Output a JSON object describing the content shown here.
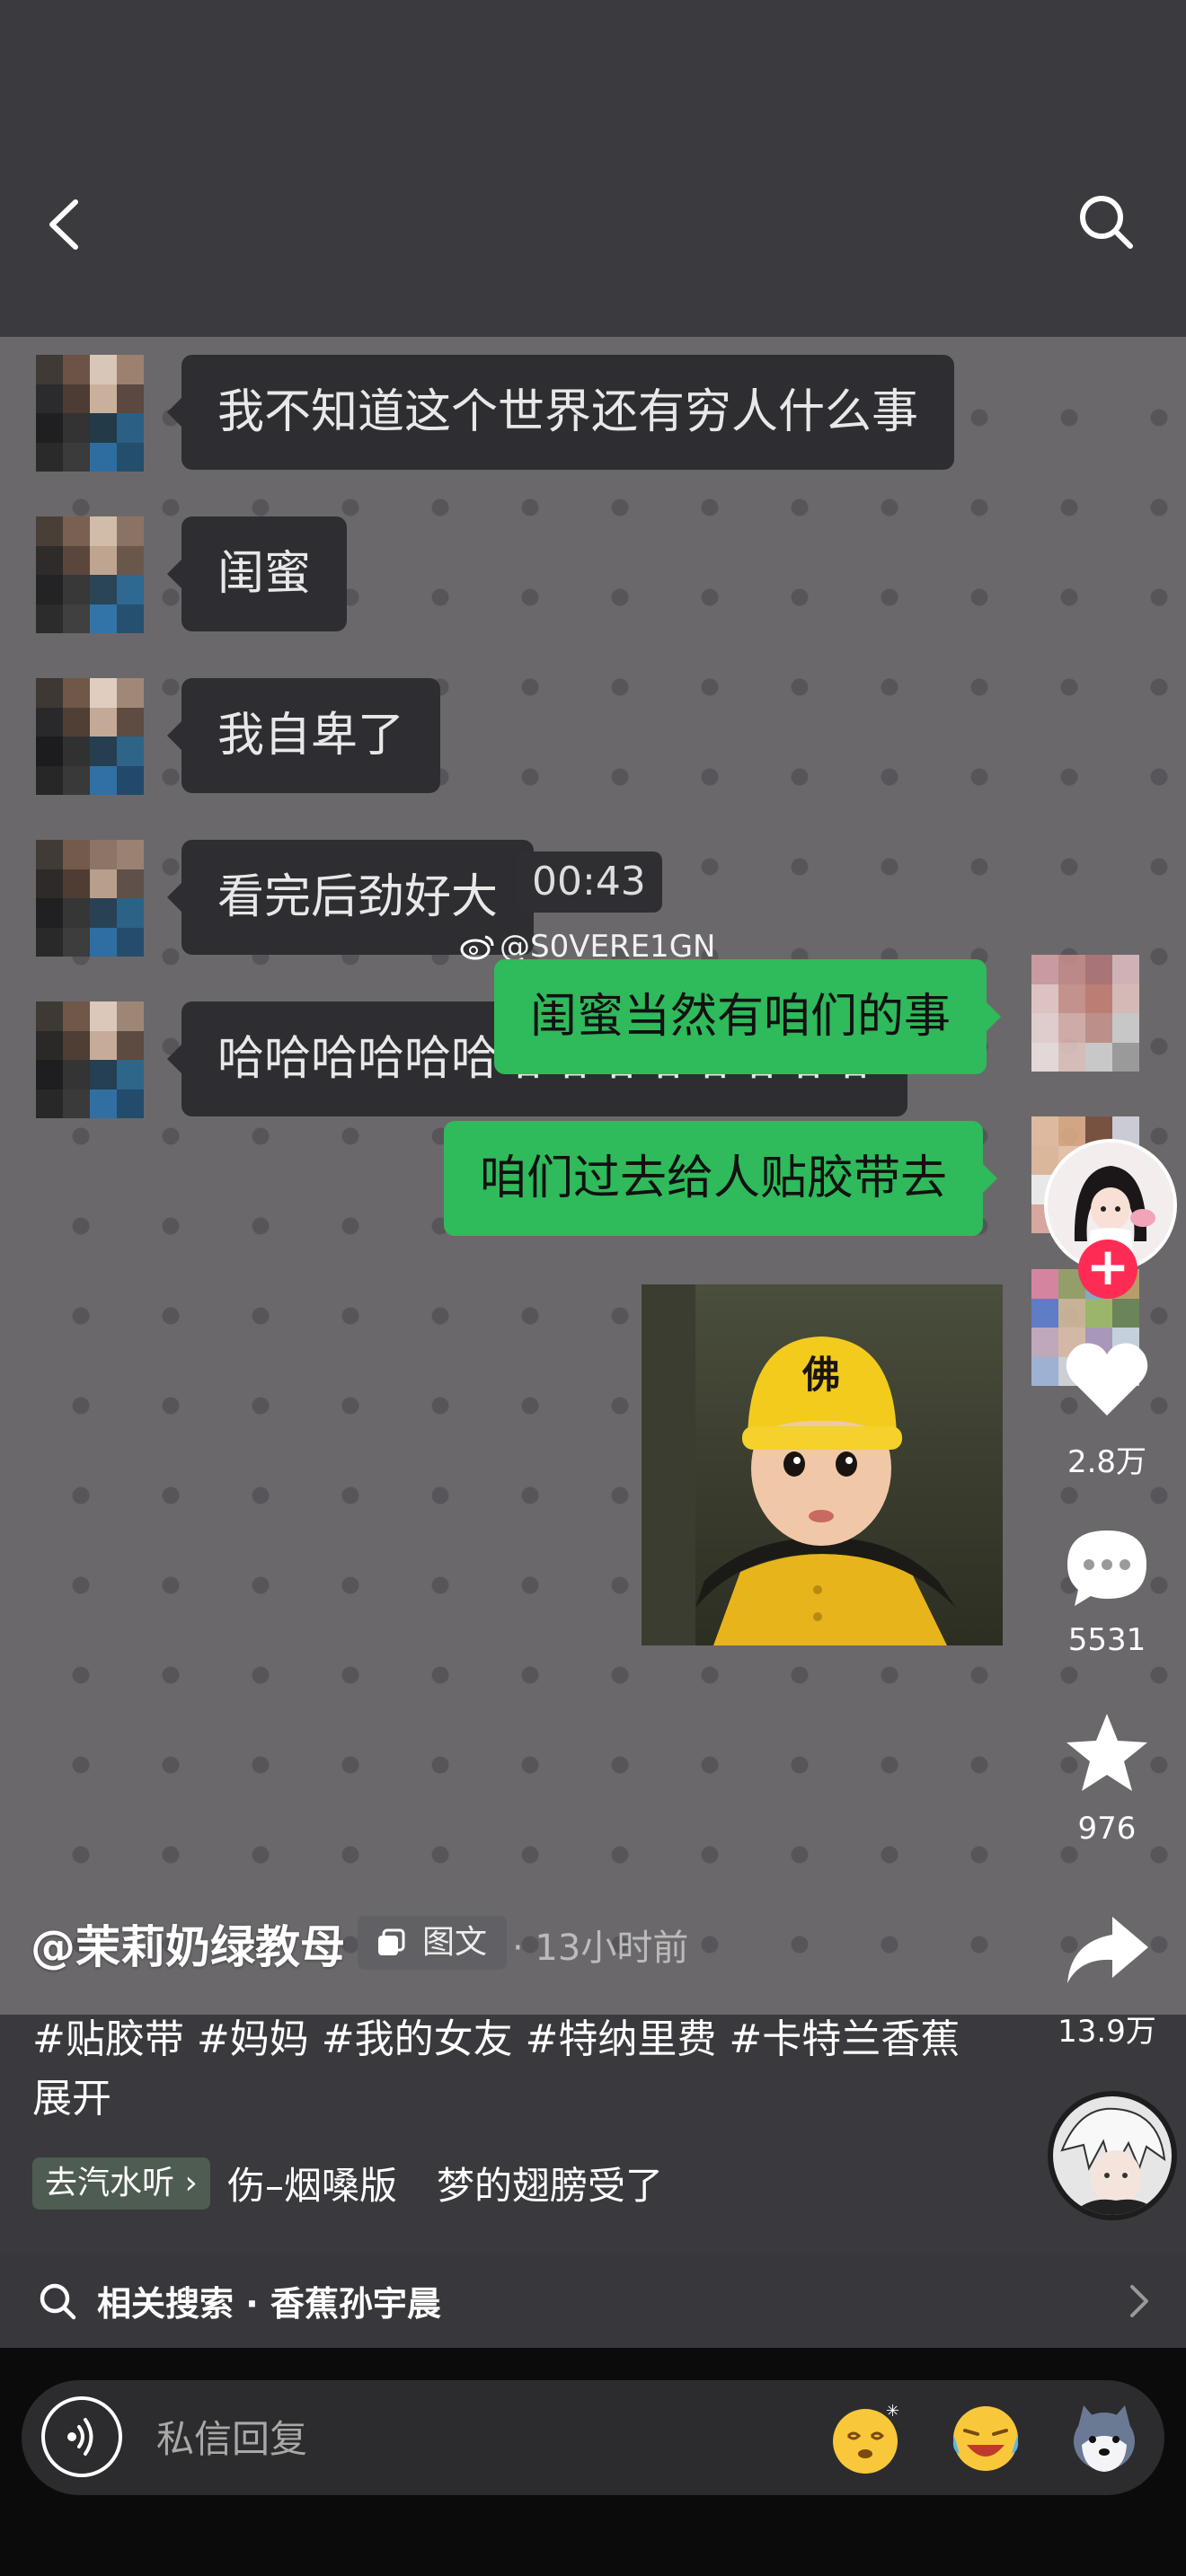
{
  "header": {
    "back_icon": "chevron-left-icon",
    "search_icon": "search-icon"
  },
  "chat": {
    "incoming": [
      "我不知道这个世界还有穷人什么事",
      "闺蜜",
      "我自卑了",
      "看完后劲好大",
      "哈哈哈哈哈哈哈哈哈哈哈哈哈哈"
    ],
    "timestamp": "00:43",
    "watermark": "@S0VERE1GN",
    "outgoing": [
      "闺蜜当然有咱们的事",
      "咱们过去给人贴胶带去"
    ]
  },
  "sidebar": {
    "follow_label": "+",
    "likes": "2.8万",
    "comments": "5531",
    "favorites": "976",
    "shares": "13.9万"
  },
  "post": {
    "author": "@茉莉奶绿教母",
    "tag_chip": "图文",
    "date": "· 13小时前",
    "hashtags": "#贴胶带 #妈妈 #我的女友 #特纳里费 #卡特兰香蕉",
    "expand": "展开",
    "music_chip": "去汽水听",
    "music_title_a": "伤–烟嗓版",
    "music_title_b": "梦的翅膀受了"
  },
  "related": {
    "label": "相关搜索 · 香蕉孙宇晨"
  },
  "reply": {
    "placeholder": "私信回复"
  },
  "colors": {
    "bubble_out": "#2fba5b",
    "bubble_in": "#2e2d31",
    "follow": "#fe2c55",
    "chat_bg": "#6b686c"
  }
}
